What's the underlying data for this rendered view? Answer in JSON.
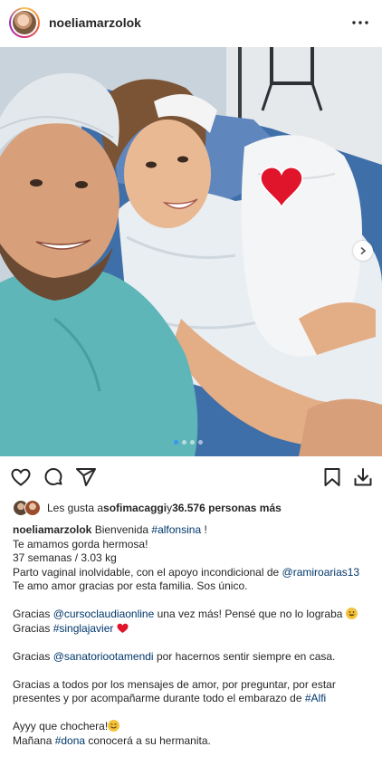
{
  "header": {
    "username": "noeliamarzolok",
    "more_icon": "more-horizontal-icon"
  },
  "post": {
    "image_icon": "photo",
    "carousel": {
      "dots": 4,
      "active_index": 0
    }
  },
  "actions": {
    "icons": [
      "heart-icon",
      "comment-icon",
      "share-icon",
      "bookmark-icon",
      "download-icon"
    ]
  },
  "likes": {
    "prefix": "Les gusta a ",
    "user": "sofimacaggi",
    "middle": " y ",
    "count": "36.576 personas más"
  },
  "caption": {
    "username": "noeliamarzolok",
    "l1_text": " Bienvenida ",
    "l1_tag": "#alfonsina",
    "l1_end": " !",
    "l2": "Te amamos gorda hermosa!",
    "l3": "37 semanas / 3.03 kg",
    "l4_text": "Parto vaginal inolvidable, con el apoyo incondicional de ",
    "l4_mention": "@ramiroarias13",
    "l5": "Te amo amor gracias por esta familia. Sos único.",
    "l6_a": "Gracias ",
    "l6_mention": "@cursoclaudiaonline",
    "l6_b": " una vez más! Pensé que no lo lograba ",
    "l7_a": "Gracias ",
    "l7_tag": "#singlajavier",
    "l8_a": "Gracias ",
    "l8_mention": "@sanatoriootamendi",
    "l8_b": " por hacernos sentir siempre en casa.",
    "l9": "Gracias a todos por los mensajes de amor, por preguntar, por estar",
    "l10_a": "presentes y por acompañarme durante todo el embarazo de ",
    "l10_tag": "#Alfi",
    "l11": "Ayyy que chochera!",
    "l12_a": "Mañana ",
    "l12_tag": "#dona",
    "l12_b": " conocerá a su hermanita."
  },
  "colors": {
    "link": "#00376b",
    "heart_emoji": "#e0142b",
    "active_dot": "#3897f0"
  }
}
